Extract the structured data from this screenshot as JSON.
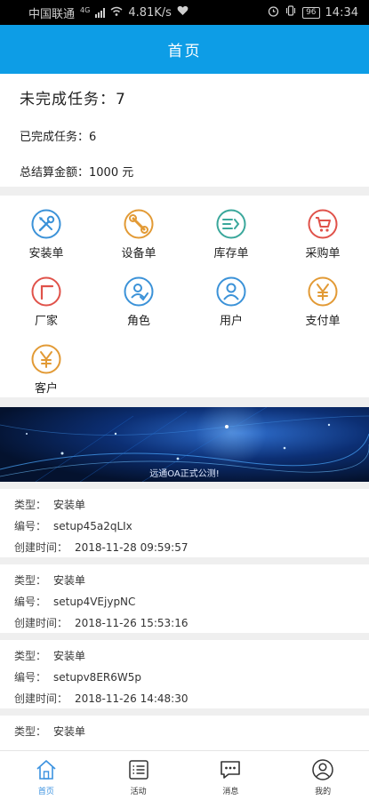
{
  "status_bar": {
    "carrier": "中国联通",
    "network": "4G",
    "speed": "4.81K/s",
    "battery": "96",
    "time": "14:34"
  },
  "header": {
    "title": "首页"
  },
  "summary": {
    "unfinished": "未完成任务：7",
    "finished": "已完成任务：6",
    "total_amount": "总结算金额：1000 元"
  },
  "grid": {
    "items": [
      {
        "label": "安装单",
        "icon": "tools-icon",
        "color": "#3b92d8"
      },
      {
        "label": "设备单",
        "icon": "wrench-icon",
        "color": "#e29a35"
      },
      {
        "label": "库存单",
        "icon": "inventory-icon",
        "color": "#3aa79b"
      },
      {
        "label": "采购单",
        "icon": "cart-icon",
        "color": "#e0524a"
      },
      {
        "label": "厂家",
        "icon": "factory-icon",
        "color": "#e0524a"
      },
      {
        "label": "角色",
        "icon": "role-icon",
        "color": "#3b92d8"
      },
      {
        "label": "用户",
        "icon": "user-icon",
        "color": "#3b92d8"
      },
      {
        "label": "支付单",
        "icon": "yen-icon",
        "color": "#e29a35"
      },
      {
        "label": "客户",
        "icon": "yen-icon",
        "color": "#e29a35"
      }
    ]
  },
  "banner": {
    "caption": "远通OA正式公测!"
  },
  "tasks": [
    {
      "type_label": "类型：",
      "type": "安装单",
      "no_label": "编号：",
      "no": "setup45a2qLIx",
      "time_label": "创建时间：",
      "time": "2018-11-28 09:59:57"
    },
    {
      "type_label": "类型：",
      "type": "安装单",
      "no_label": "编号：",
      "no": "setup4VEjypNC",
      "time_label": "创建时间：",
      "time": "2018-11-26 15:53:16"
    },
    {
      "type_label": "类型：",
      "type": "安装单",
      "no_label": "编号：",
      "no": "setupv8ER6W5p",
      "time_label": "创建时间：",
      "time": "2018-11-26 14:48:30"
    },
    {
      "type_label": "类型：",
      "type": "安装单"
    }
  ],
  "tabbar": {
    "items": [
      {
        "label": "首页",
        "icon": "home-icon"
      },
      {
        "label": "活动",
        "icon": "list-icon"
      },
      {
        "label": "消息",
        "icon": "message-icon"
      },
      {
        "label": "我的",
        "icon": "profile-icon"
      }
    ],
    "active_color": "#3b92e0"
  }
}
